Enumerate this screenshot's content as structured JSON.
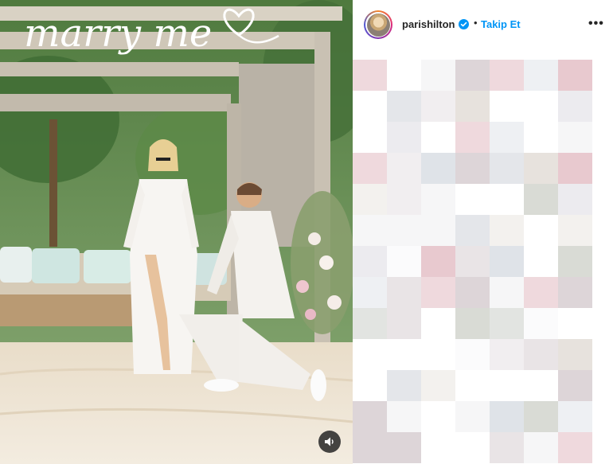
{
  "post": {
    "overlay_text": "marry me",
    "sound_icon": "speaker-icon"
  },
  "header": {
    "username": "parishilton",
    "verified_icon": "verified-badge-icon",
    "separator": "•",
    "follow_label": "Takip Et",
    "more_icon": "more-options-icon",
    "more_label": "•••"
  },
  "colors": {
    "follow_blue": "#0095f6",
    "verified_blue": "#0095f6",
    "text_dark": "#262626"
  },
  "comments_area": {
    "state": "pixelated"
  }
}
